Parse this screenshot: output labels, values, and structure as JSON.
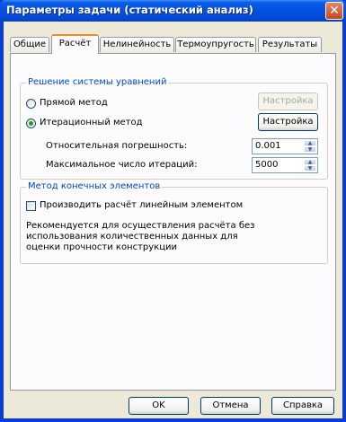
{
  "window": {
    "title": "Параметры задачи (статический анализ)",
    "close_glyph": "✕"
  },
  "tabs": [
    {
      "label": "Общие"
    },
    {
      "label": "Расчёт"
    },
    {
      "label": "Нелинейность"
    },
    {
      "label": "Термоупругость"
    },
    {
      "label": "Результаты"
    }
  ],
  "solver_group": {
    "title": "Решение системы уравнений",
    "direct_method": {
      "label": "Прямой метод",
      "selected": false,
      "settings_label": "Настройка"
    },
    "iterative_method": {
      "label": "Итерационный метод",
      "selected": true,
      "settings_label": "Настройка"
    },
    "relative_error": {
      "label": "Относительная погрешность:",
      "value": "0.001"
    },
    "max_iterations": {
      "label": "Максимальное число итераций:",
      "value": "5000"
    }
  },
  "fem_group": {
    "title": "Метод конечных элементов",
    "linear_element": {
      "label": "Производить расчёт линейным элементом",
      "checked": false
    },
    "note": "Рекомендуется для осуществления расчёта без использования количественных данных для оценки прочности конструкции"
  },
  "footer": {
    "ok_label": "OK",
    "cancel_label": "Отмена",
    "help_label": "Справка"
  },
  "colors": {
    "titlebar": "#0551e0",
    "group_title": "#0046d5",
    "active_tab_accent": "#e68b2c",
    "dialog_bg": "#ece9d8"
  }
}
